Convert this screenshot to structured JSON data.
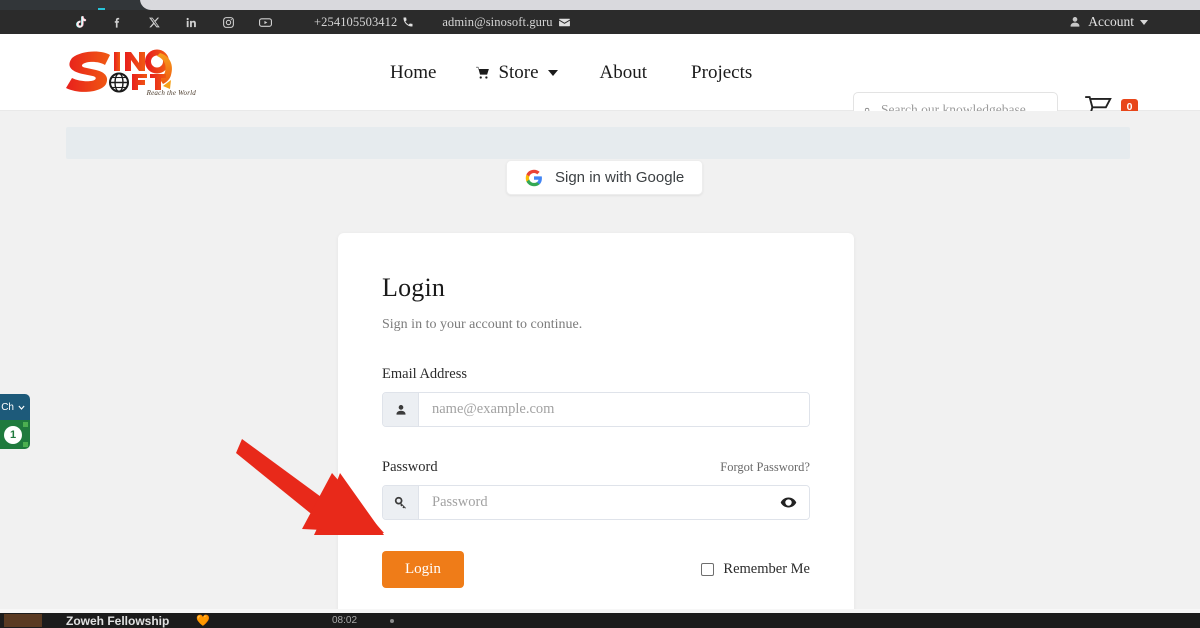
{
  "topbar": {
    "social": [
      {
        "name": "tiktok",
        "label": "TikTok"
      },
      {
        "name": "facebook",
        "label": "Facebook"
      },
      {
        "name": "x-twitter",
        "label": "X"
      },
      {
        "name": "linkedin",
        "label": "LinkedIn"
      },
      {
        "name": "instagram",
        "label": "Instagram"
      },
      {
        "name": "youtube",
        "label": "YouTube"
      }
    ],
    "phone": "+254105503412",
    "email": "admin@sinosoft.guru",
    "account_label": "Account"
  },
  "header": {
    "logo": {
      "top_text": "SINO",
      "bottom_text": "SOFT",
      "tagline": "Reach the World"
    },
    "nav": [
      {
        "label": "Home",
        "icon": ""
      },
      {
        "label": "Store",
        "icon": "cart-icon",
        "has_dropdown": true
      },
      {
        "label": "About",
        "icon": ""
      },
      {
        "label": "Projects",
        "icon": ""
      }
    ],
    "search": {
      "placeholder": "Search our knowledgebase",
      "value": ""
    },
    "cart": {
      "count": "0"
    }
  },
  "main": {
    "google_button": {
      "label": "Sign in with Google"
    },
    "login_card": {
      "title": "Login",
      "subtitle": "Sign in to your account to continue.",
      "email_label": "Email Address",
      "email_placeholder": "name@example.com",
      "email_value": "",
      "password_label": "Password",
      "password_placeholder": "Password",
      "password_value": "",
      "forgot_label": "Forgot Password?",
      "submit_label": "Login",
      "remember_label": "Remember Me"
    }
  },
  "chat_widget": {
    "header_label": "Ch",
    "unread_count": "1"
  },
  "taskbar": {
    "title": "Zoweh Fellowship",
    "emoji": "🧡",
    "time": "08:02"
  },
  "colors": {
    "accent_orange": "#ef7c18",
    "badge_red": "#e8461a",
    "topbar_dark": "#2b2b2b",
    "page_bg": "#f1f1f1",
    "arrow_red": "#e8291a",
    "chat_green": "#1f7a3d",
    "chat_blue": "#1d5a7a"
  }
}
